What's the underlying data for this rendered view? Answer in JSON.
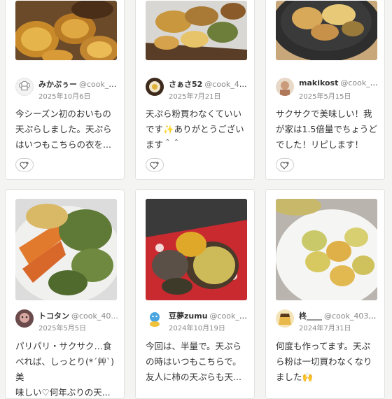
{
  "posts": [
    {
      "user": "みかぷぅー",
      "user_id": "@cook_4...",
      "date": "2025年10月6日",
      "comment_lines": [
        "今シーズン初のおいもの",
        "天ぷらしました。天ぷら",
        "はいつもこちらの衣を..."
      ],
      "avatar_icon": "chef-hat-icon",
      "photo": "sweet-potato-tempura"
    },
    {
      "user": "さぁさ52",
      "user_id": "@cook_40...",
      "date": "2025年7月21日",
      "comment_lines": [
        "天ぷら粉買わなくていい",
        "です✨ありがとうござい",
        "ます＾＾"
      ],
      "avatar_icon": "photo-avatar",
      "photo": "mixed-tempura-on-paper"
    },
    {
      "user": "makikost",
      "user_id": "@cook_4...",
      "date": "2025年5月15日",
      "comment_lines": [
        "サクサクで美味しい！我",
        "が家は1.5倍量でちょうど",
        "でした！リピします！"
      ],
      "avatar_icon": "photo-avatar",
      "photo": "tempura-on-dark-plate"
    },
    {
      "user": "トコタン",
      "user_id": "@cook_40...",
      "date": "2025年5月5日",
      "comment_lines": [
        "パリパリ・サクサク…食",
        "べれば、しっとり(*´艸`)美",
        "味しい♡何年ぶりの天..."
      ],
      "avatar_icon": "photo-avatar",
      "photo": "vegetable-kakiage"
    },
    {
      "user": "豆夢zumu",
      "user_id": "@cook_4...",
      "date": "2024年10月19日",
      "comment_lines": [
        "今回は、半量で。天ぷら",
        "の時はいつもこちらで。",
        "友人に柿の天ぷらも天..."
      ],
      "avatar_icon": "character-avatar",
      "photo": "eggplant-tempura-red-cloth"
    },
    {
      "user": "柊____",
      "user_id": "@cook_4038...",
      "date": "2024年7月31日",
      "comment_lines": [
        "何度も作ってます。天ぷ",
        "ら粉は一切買わなくなり",
        "ました🙌"
      ],
      "avatar_icon": "pudding-avatar",
      "photo": "zucchini-tempura"
    }
  ],
  "like_icon": "heart-plus-icon",
  "colors": {
    "background": "#f4f4f2",
    "card": "#ffffff",
    "border": "#e2e2e0",
    "muted": "#8a8a8a"
  }
}
